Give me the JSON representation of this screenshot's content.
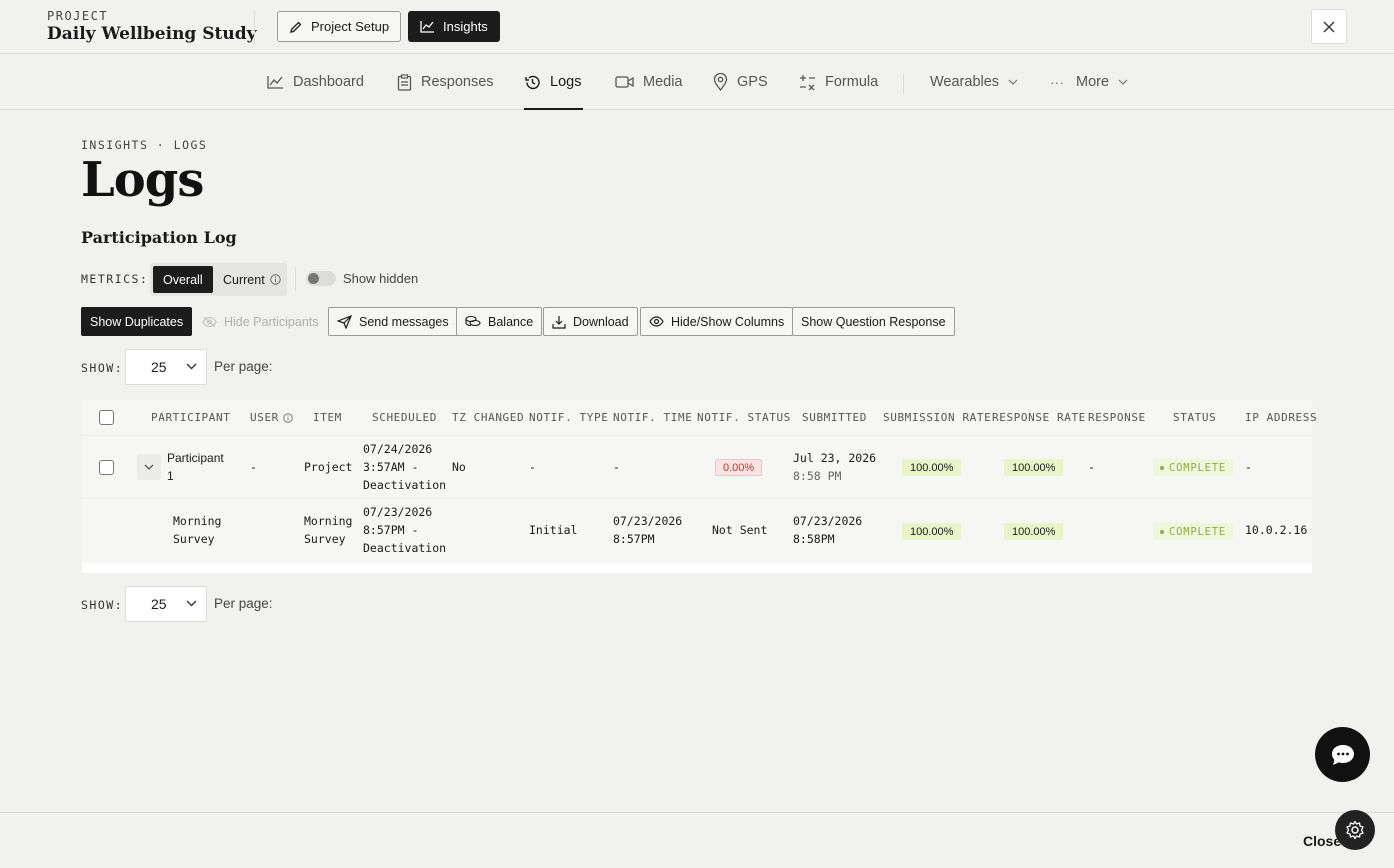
{
  "project": {
    "kicker": "PROJECT",
    "name": "Daily Wellbeing Study"
  },
  "top_buttons": {
    "setup": "Project Setup",
    "insights": "Insights"
  },
  "nav": {
    "dashboard": "Dashboard",
    "responses": "Responses",
    "logs": "Logs",
    "media": "Media",
    "gps": "GPS",
    "formula": "Formula",
    "wearables": "Wearables",
    "more": "More",
    "more_dots": "···"
  },
  "page": {
    "breadcrumb": "INSIGHTS · LOGS",
    "title": "Logs",
    "section_title": "Participation Log"
  },
  "metrics": {
    "label": "METRICS:",
    "overall": "Overall",
    "current": "Current",
    "show_hidden": "Show hidden"
  },
  "actions": {
    "show_duplicates": "Show Duplicates",
    "hide_participants": "Hide Participants",
    "send_messages": "Send messages",
    "balance": "Balance",
    "download": "Download",
    "hide_show_columns": "Hide/Show Columns",
    "show_question_response": "Show Question Response"
  },
  "pagination": {
    "show_label": "SHOW:",
    "value": "25",
    "per_page": "Per page:"
  },
  "table": {
    "headers": {
      "participant": "PARTICIPANT",
      "user": "USER",
      "item": "ITEM",
      "scheduled": "SCHEDULED",
      "tz_changed": "TZ CHANGED",
      "notif_type": "NOTIF. TYPE",
      "notif_time": "NOTIF. TIME",
      "notif_status": "NOTIF. STATUS",
      "submitted": "SUBMITTED",
      "submission_rate": "SUBMISSION RATE",
      "response_rate": "RESPONSE RATE",
      "response": "RESPONSE",
      "status": "STATUS",
      "ip_address": "IP ADDRESS"
    },
    "rows": [
      {
        "participant_l1": "Participant",
        "participant_l2": "1",
        "user": "-",
        "item": "Project",
        "scheduled_l1": "07/24/2026",
        "scheduled_l2": "3:57AM -",
        "scheduled_l3": "Deactivation",
        "tz_changed": "No",
        "notif_type": "-",
        "notif_time": "-",
        "notif_status": "0.00%",
        "submitted_l1": "Jul 23, 2026",
        "submitted_l2": "8:58 PM",
        "submission_rate": "100.00%",
        "response_rate": "100.00%",
        "response": "-",
        "status": "COMPLETE",
        "ip_address": "-"
      },
      {
        "participant_l1": "Morning",
        "participant_l2": "Survey",
        "item_l1": "Morning",
        "item_l2": "Survey",
        "scheduled_l1": "07/23/2026",
        "scheduled_l2": "8:57PM -",
        "scheduled_l3": "Deactivation",
        "notif_type": "Initial",
        "notif_time_l1": "07/23/2026",
        "notif_time_l2": "8:57PM",
        "notif_status": "Not Sent",
        "submitted_l1": "07/23/2026",
        "submitted_l2": "8:58PM",
        "submission_rate": "100.00%",
        "response_rate": "100.00%",
        "status": "COMPLETE",
        "ip_address": "10.0.2.16"
      }
    ]
  },
  "footer": {
    "close": "Close"
  },
  "colors": {
    "accent_dark": "#1c1c1c",
    "status_green": "#8fae43",
    "rate_bg": "#e9f5c8",
    "alert_red": "#c0352b"
  }
}
